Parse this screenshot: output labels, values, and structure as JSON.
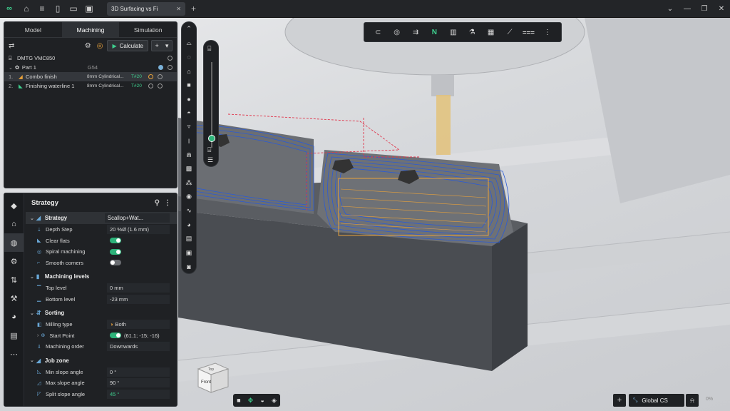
{
  "titlebar": {
    "tab_title": "3D Surfacing vs Fi",
    "close_glyph": "✕",
    "new_tab_glyph": "+"
  },
  "machining_panel": {
    "tabs": [
      "Model",
      "Machining",
      "Simulation"
    ],
    "active_tab": "Machining",
    "calculate_label": "Calculate",
    "add_label": "+",
    "machine": "DMTG VMC850",
    "part": "Part 1",
    "part_cs": "G54",
    "operations": [
      {
        "num": "1.",
        "name": "Combo finish",
        "tool": "8mm Cylindrical...",
        "holder": "T#20"
      },
      {
        "num": "2.",
        "name": "Finishing waterline 1",
        "tool": "8mm Cylindrical...",
        "holder": "T#20"
      }
    ]
  },
  "strategy_panel": {
    "title": "Strategy",
    "rows": {
      "strategy_label": "Strategy",
      "strategy_value": "Scallop+Wat...",
      "depth_step_label": "Depth Step",
      "depth_step_value": "20 %Ø (1.6 mm)",
      "clear_flats_label": "Clear flats",
      "spiral_label": "Spiral machining",
      "smooth_label": "Smooth corners"
    },
    "machining_levels": {
      "title": "Machining levels",
      "top_label": "Top level",
      "top_value": "0 mm",
      "bottom_label": "Bottom level",
      "bottom_value": "-23 mm"
    },
    "sorting": {
      "title": "Sorting",
      "milling_type_label": "Milling type",
      "milling_type_value": "Both",
      "start_point_label": "Start Point",
      "start_point_value": "(61.1; -15; -16)",
      "order_label": "Machining order",
      "order_value": "Downwards"
    },
    "job_zone": {
      "title": "Job zone",
      "min_label": "Min slope angle",
      "min_value": "0 °",
      "max_label": "Max slope angle",
      "max_value": "90 °",
      "split_label": "Split slope angle",
      "split_value": "45 °"
    }
  },
  "viewcube": {
    "top": "Top",
    "front": "Front"
  },
  "status": {
    "coordinate_system": "Global CS",
    "zoom": "0%"
  },
  "colors": {
    "accent": "#2db37a",
    "toolpath_blue": "#2a5bd7",
    "toolpath_orange": "#e9a23b",
    "toolpath_red": "#e0344a"
  }
}
